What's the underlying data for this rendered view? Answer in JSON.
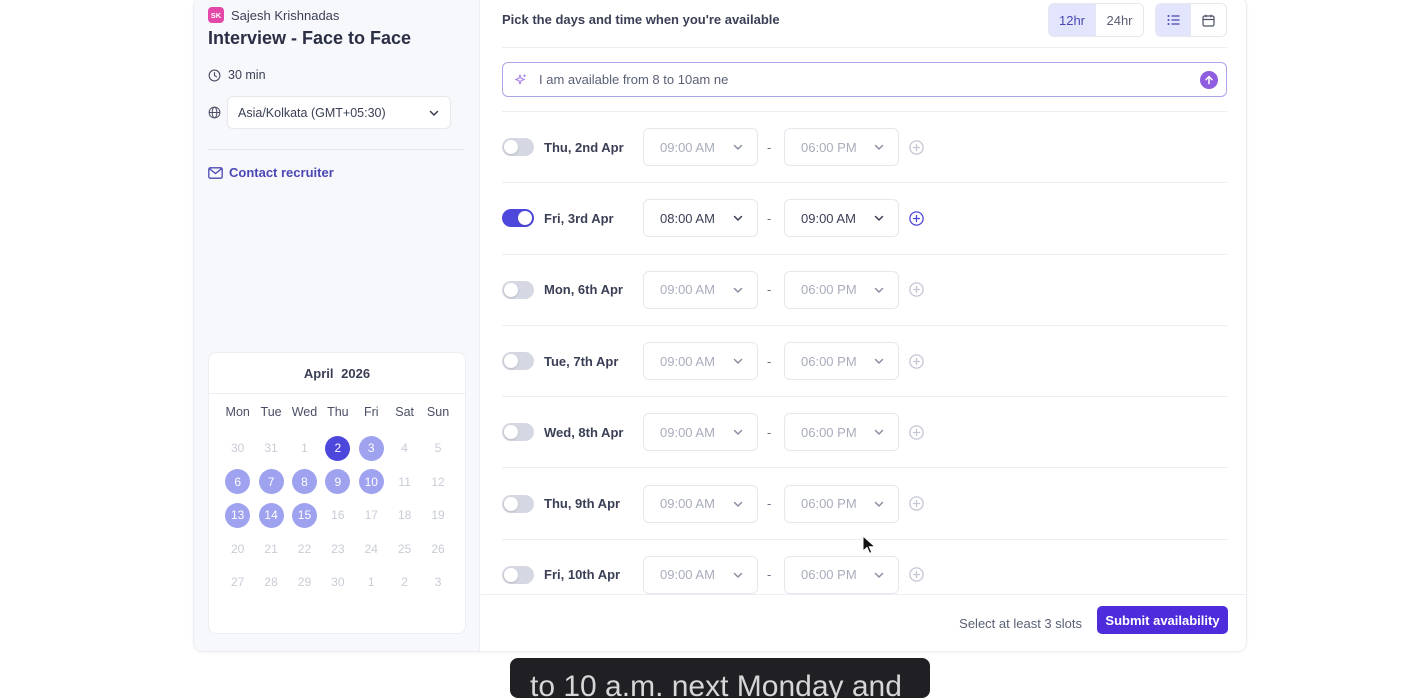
{
  "host": {
    "initials": "SK",
    "name": "Sajesh Krishnadas"
  },
  "event": {
    "title": "Interview - Face to Face",
    "duration": "30 min"
  },
  "timezone": {
    "value": "Asia/Kolkata (GMT+05:30)"
  },
  "contact": {
    "label": "Contact recruiter"
  },
  "calendar": {
    "month": "April",
    "year": "2026",
    "weekdays": [
      "Mon",
      "Tue",
      "Wed",
      "Thu",
      "Fri",
      "Sat",
      "Sun"
    ],
    "weeks": [
      [
        {
          "d": "30",
          "s": "out"
        },
        {
          "d": "31",
          "s": "out"
        },
        {
          "d": "1",
          "s": "dis"
        },
        {
          "d": "2",
          "s": "sel"
        },
        {
          "d": "3",
          "s": "avail"
        },
        {
          "d": "4",
          "s": "dis"
        },
        {
          "d": "5",
          "s": "dis"
        }
      ],
      [
        {
          "d": "6",
          "s": "avail"
        },
        {
          "d": "7",
          "s": "avail"
        },
        {
          "d": "8",
          "s": "avail"
        },
        {
          "d": "9",
          "s": "avail"
        },
        {
          "d": "10",
          "s": "avail"
        },
        {
          "d": "11",
          "s": "dis"
        },
        {
          "d": "12",
          "s": "dis"
        }
      ],
      [
        {
          "d": "13",
          "s": "avail"
        },
        {
          "d": "14",
          "s": "avail"
        },
        {
          "d": "15",
          "s": "avail"
        },
        {
          "d": "16",
          "s": "dis"
        },
        {
          "d": "17",
          "s": "dis"
        },
        {
          "d": "18",
          "s": "dis"
        },
        {
          "d": "19",
          "s": "dis"
        }
      ],
      [
        {
          "d": "20",
          "s": "dis"
        },
        {
          "d": "21",
          "s": "dis"
        },
        {
          "d": "22",
          "s": "dis"
        },
        {
          "d": "23",
          "s": "dis"
        },
        {
          "d": "24",
          "s": "dis"
        },
        {
          "d": "25",
          "s": "dis"
        },
        {
          "d": "26",
          "s": "dis"
        }
      ],
      [
        {
          "d": "27",
          "s": "dis"
        },
        {
          "d": "28",
          "s": "dis"
        },
        {
          "d": "29",
          "s": "dis"
        },
        {
          "d": "30",
          "s": "dis"
        },
        {
          "d": "1",
          "s": "out"
        },
        {
          "d": "2",
          "s": "out"
        },
        {
          "d": "3",
          "s": "out"
        }
      ]
    ]
  },
  "header": {
    "prompt_label": "Pick the days and time when you're available",
    "format_12": "12hr",
    "format_24": "24hr",
    "active_format": "12hr",
    "active_view": "list"
  },
  "ai_input": {
    "value": "I am available from 8 to 10am ne"
  },
  "slots": [
    {
      "day": "Thu, 2nd Apr",
      "enabled": false,
      "start": "09:00 AM",
      "end": "06:00 PM"
    },
    {
      "day": "Fri, 3rd Apr",
      "enabled": true,
      "start": "08:00 AM",
      "end": "09:00 AM"
    },
    {
      "day": "Mon, 6th Apr",
      "enabled": false,
      "start": "09:00 AM",
      "end": "06:00 PM"
    },
    {
      "day": "Tue, 7th Apr",
      "enabled": false,
      "start": "09:00 AM",
      "end": "06:00 PM"
    },
    {
      "day": "Wed, 8th Apr",
      "enabled": false,
      "start": "09:00 AM",
      "end": "06:00 PM"
    },
    {
      "day": "Thu, 9th Apr",
      "enabled": false,
      "start": "09:00 AM",
      "end": "06:00 PM"
    },
    {
      "day": "Fri, 10th Apr",
      "enabled": false,
      "start": "09:00 AM",
      "end": "06:00 PM"
    }
  ],
  "slot_separator": "-",
  "footer": {
    "hint": "Select at least 3 slots",
    "submit_label": "Submit availability"
  },
  "caption": {
    "text": "to 10 a.m. next Monday and"
  },
  "colors": {
    "accent": "#4e47dc",
    "submit": "#4e2bdb",
    "available_day": "#9ea2ef"
  }
}
